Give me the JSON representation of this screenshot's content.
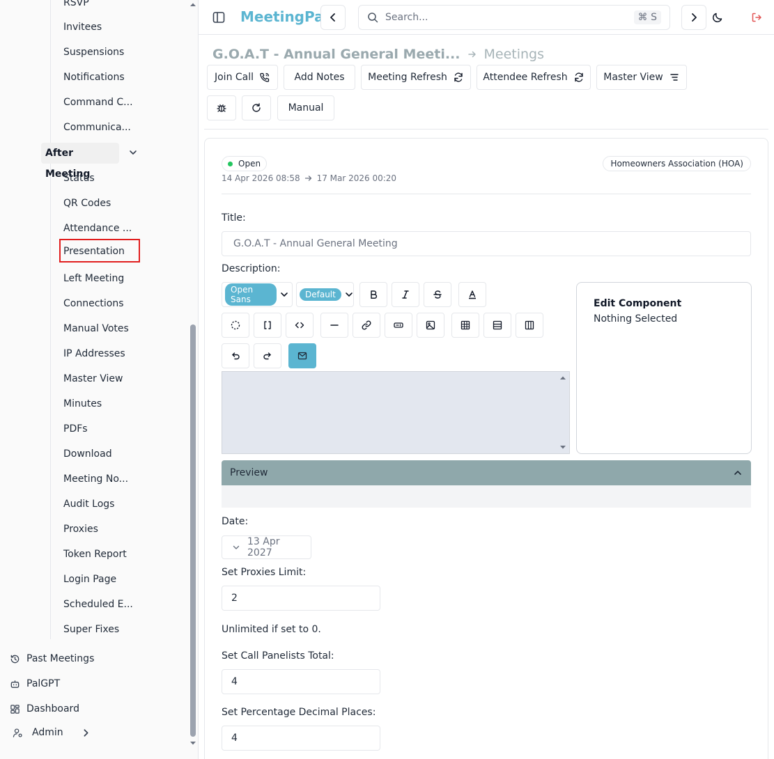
{
  "sidebar": {
    "items_top": [
      {
        "label": "RSVP"
      },
      {
        "label": "Invitees"
      },
      {
        "label": "Suspensions"
      },
      {
        "label": "Notifications"
      },
      {
        "label": "Command C..."
      },
      {
        "label": "Communica..."
      }
    ],
    "section_label": "After Meeting",
    "items": [
      {
        "label": "Status"
      },
      {
        "label": "QR Codes"
      },
      {
        "label": "Attendance ..."
      },
      {
        "label": "Presentation"
      },
      {
        "label": "Left Meeting"
      },
      {
        "label": "Connections"
      },
      {
        "label": "Manual Votes"
      },
      {
        "label": "IP Addresses"
      },
      {
        "label": "Master View"
      },
      {
        "label": "Minutes"
      },
      {
        "label": "PDFs"
      },
      {
        "label": "Download"
      },
      {
        "label": "Meeting No..."
      },
      {
        "label": "Audit Logs"
      },
      {
        "label": "Proxies"
      },
      {
        "label": "Token Report"
      },
      {
        "label": "Login Page"
      },
      {
        "label": "Scheduled E..."
      },
      {
        "label": "Super Fixes"
      }
    ],
    "bottom": {
      "past_meetings": "Past Meetings",
      "palgpt": "PalGPT",
      "dashboard": "Dashboard",
      "admin": "Admin"
    }
  },
  "header": {
    "brand": "MeetingPal",
    "search_placeholder": "Search...",
    "search_shortcut": "⌘ S"
  },
  "breadcrumb": {
    "title": "G.O.A.T - Annual General Meeti...",
    "parent": "Meetings"
  },
  "toolbar": {
    "join_call": "Join Call",
    "add_notes": "Add Notes",
    "meeting_refresh": "Meeting Refresh",
    "attendee_refresh": "Attendee Refresh",
    "master_view": "Master View",
    "manual": "Manual"
  },
  "meeting": {
    "status": "Open",
    "start": "14 Apr 2026 08:58",
    "end": "17 Mar 2026 00:20",
    "organization": "Homeowners Association (HOA)"
  },
  "form": {
    "title_label": "Title:",
    "title_value": "G.O.A.T - Annual General Meeting",
    "description_label": "Description:",
    "font_family": "Open Sans",
    "font_size": "Default",
    "edit_component_title": "Edit Component",
    "edit_component_text": "Nothing Selected",
    "preview_label": "Preview",
    "date_label": "Date:",
    "date_value": "13 Apr 2027",
    "proxies_label": "Set Proxies Limit:",
    "proxies_value": "2",
    "proxies_helper": "Unlimited if set to 0.",
    "panelists_label": "Set Call Panelists Total:",
    "panelists_value": "4",
    "decimals_label": "Set Percentage Decimal Places:",
    "decimals_value": "4"
  },
  "colors": {
    "brand": "#5bb5d1",
    "status_open": "#22c55e",
    "preview_bar": "#8fa8ab",
    "highlight": "#e11d1d"
  }
}
